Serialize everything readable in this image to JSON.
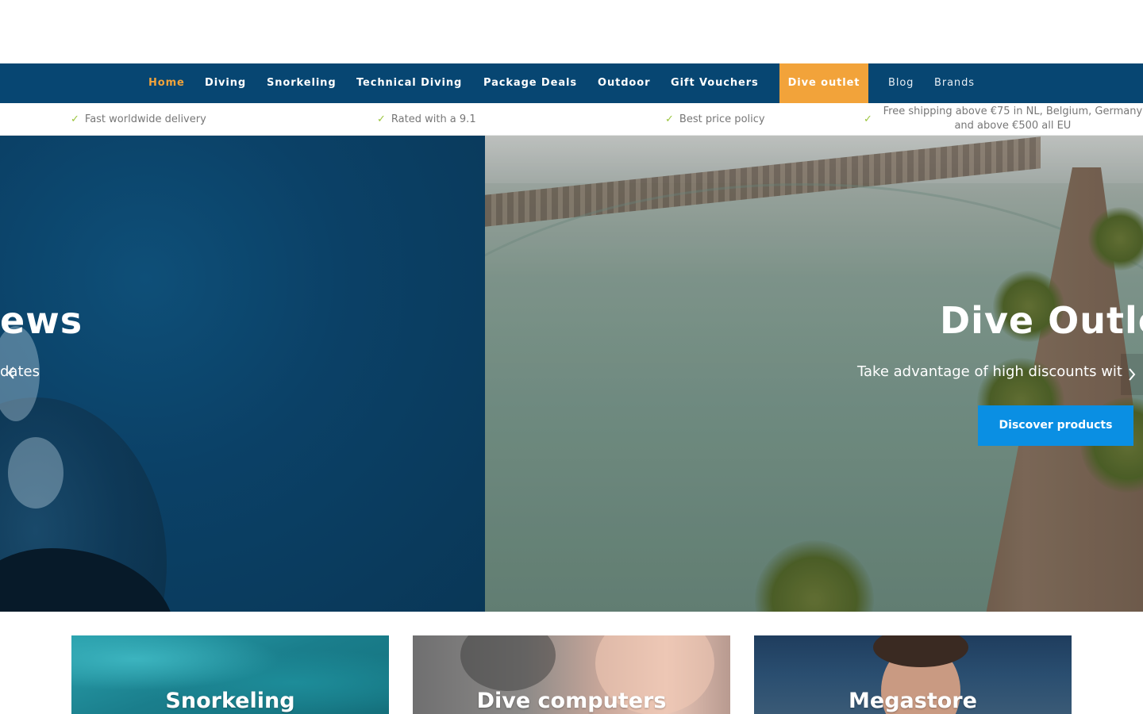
{
  "nav": {
    "items": [
      {
        "label": "Home",
        "state": "active"
      },
      {
        "label": "Diving"
      },
      {
        "label": "Snorkeling"
      },
      {
        "label": "Technical Diving"
      },
      {
        "label": "Package Deals"
      },
      {
        "label": "Outdoor"
      },
      {
        "label": "Gift Vouchers"
      },
      {
        "label": "Dive outlet",
        "state": "highlighted"
      },
      {
        "label": "Blog"
      },
      {
        "label": "Brands"
      }
    ]
  },
  "usps": [
    {
      "icon": "check-icon",
      "text": "Fast worldwide delivery"
    },
    {
      "icon": "check-icon",
      "text": "Rated with a 9.1"
    },
    {
      "icon": "check-icon",
      "text": "Best price policy"
    },
    {
      "icon": "check-icon",
      "text": "Free shipping above €75 in NL, Belgium, Germany and above €500 all EU"
    }
  ],
  "hero": {
    "slide_left": {
      "title_visible": "ews",
      "subtitle_visible": "dates"
    },
    "slide_right": {
      "title_visible": "Dive Outle",
      "subtitle_visible": "Take advantage of high discounts wit",
      "cta_label": "Discover products"
    },
    "prev_icon": "chevron-left-icon",
    "next_icon": "chevron-right-icon"
  },
  "categories": [
    {
      "label": "Snorkeling"
    },
    {
      "label": "Dive computers"
    },
    {
      "label": "Megastore"
    }
  ],
  "colors": {
    "nav_bg": "#074672",
    "accent_orange": "#f2a33a",
    "cta_blue": "#0a8fe3",
    "check_green": "#9bc53d"
  }
}
